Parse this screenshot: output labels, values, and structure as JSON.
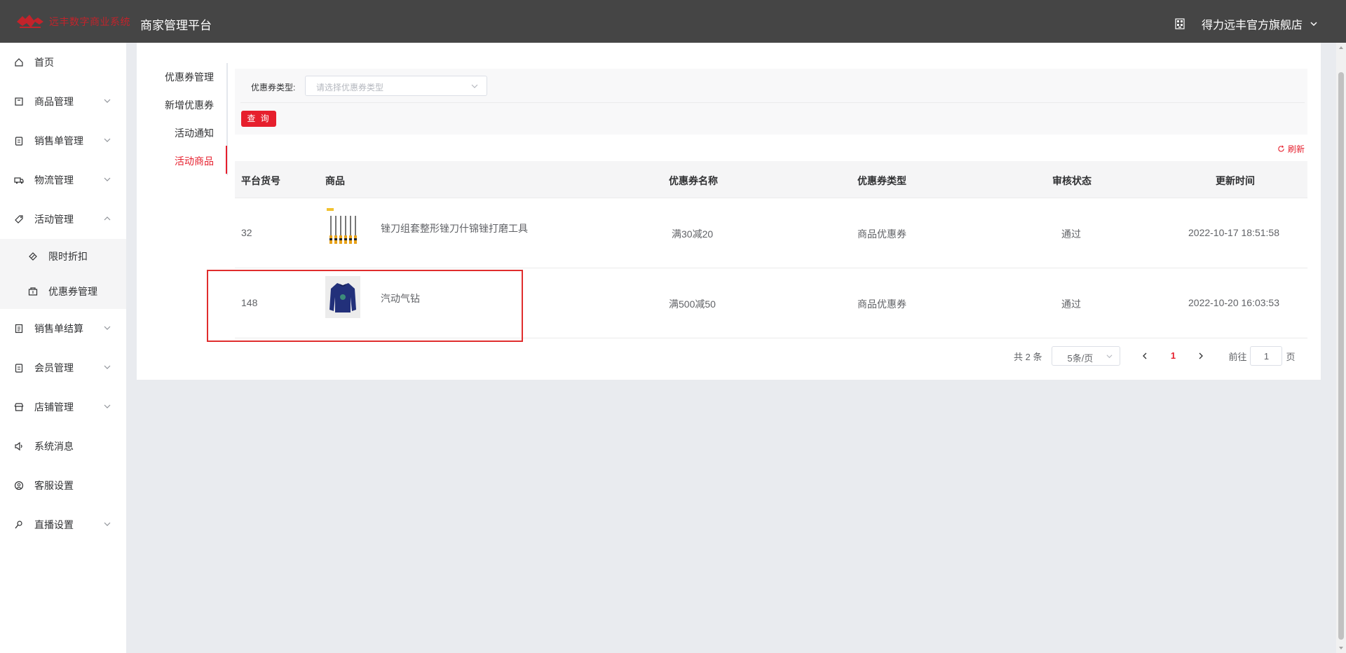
{
  "header": {
    "logo_text": "远丰数字商业系统",
    "platform_title": "商家管理平台",
    "shop_name": "得力远丰官方旗舰店"
  },
  "sidebar": {
    "items": [
      {
        "label": "首页",
        "icon": "home-icon",
        "expandable": false
      },
      {
        "label": "商品管理",
        "icon": "goods-icon",
        "expandable": true
      },
      {
        "label": "销售单管理",
        "icon": "clipboard-icon",
        "expandable": true
      },
      {
        "label": "物流管理",
        "icon": "truck-icon",
        "expandable": true
      },
      {
        "label": "活动管理",
        "icon": "tag-icon",
        "expandable": true,
        "expanded": true
      },
      {
        "label": "销售单结算",
        "icon": "document-icon",
        "expandable": true
      },
      {
        "label": "会员管理",
        "icon": "member-icon",
        "expandable": true
      },
      {
        "label": "店铺管理",
        "icon": "store-icon",
        "expandable": true
      },
      {
        "label": "系统消息",
        "icon": "speaker-icon",
        "expandable": false
      },
      {
        "label": "客服设置",
        "icon": "service-icon",
        "expandable": false
      },
      {
        "label": "直播设置",
        "icon": "live-icon",
        "expandable": true
      }
    ],
    "sub_items": [
      {
        "label": "限时折扣",
        "icon": "discount-icon"
      },
      {
        "label": "优惠券管理",
        "icon": "coupon-icon"
      }
    ]
  },
  "tabs": [
    {
      "label": "优惠券管理",
      "active": false
    },
    {
      "label": "新增优惠券",
      "active": false
    },
    {
      "label": "活动通知",
      "active": false
    },
    {
      "label": "活动商品",
      "active": true
    }
  ],
  "filter": {
    "label": "优惠券类型:",
    "placeholder": "请选择优惠券类型",
    "query_button": "查 询"
  },
  "refresh_label": "刷新",
  "table": {
    "columns": [
      "平台货号",
      "商品",
      "优惠券名称",
      "优惠券类型",
      "审核状态",
      "更新时间"
    ],
    "rows": [
      {
        "sku": "32",
        "product": "锉刀组套整形锉刀什锦锉打磨工具",
        "coupon_name": "满30减20",
        "coupon_type": "商品优惠券",
        "status": "通过",
        "updated": "2022-10-17 18:51:58"
      },
      {
        "sku": "148",
        "product": "汽动气钻",
        "coupon_name": "满500减50",
        "coupon_type": "商品优惠券",
        "status": "通过",
        "updated": "2022-10-20 16:03:53"
      }
    ]
  },
  "pagination": {
    "total": "共 2 条",
    "page_size": "5条/页",
    "current_page": "1",
    "goto_prefix": "前往",
    "goto_value": "1",
    "goto_suffix": "页"
  },
  "colors": {
    "accent": "#e61f2d",
    "header_bg": "#454545",
    "page_bg": "#e9ebef"
  }
}
